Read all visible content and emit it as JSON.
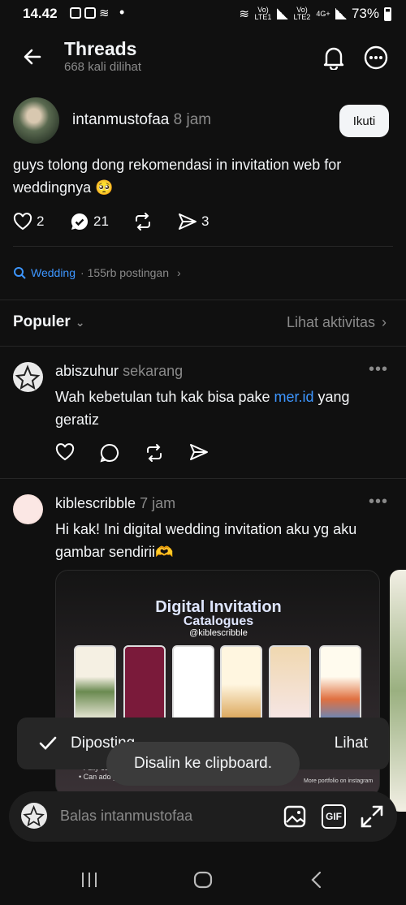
{
  "status_bar": {
    "time": "14.42",
    "network1": "Vo) LTE1",
    "network2": "Vo) LTE2",
    "network_type": "4G+",
    "battery": "73%"
  },
  "header": {
    "title": "Threads",
    "subtitle": "668 kali dilihat"
  },
  "post": {
    "username": "intanmustofaa",
    "time": "8 jam",
    "follow_label": "Ikuti",
    "text": "guys tolong dong rekomendasi in invitation web for weddingnya 🥺",
    "likes": "2",
    "replies": "21",
    "shares": "3"
  },
  "topic": {
    "name": "Wedding",
    "count": "· 155rb postingan"
  },
  "sort": {
    "label": "Populer",
    "activity": "Lihat aktivitas"
  },
  "replies": [
    {
      "username": "abiszuhur",
      "time": "sekarang",
      "text_before": "Wah kebetulan tuh kak bisa pake ",
      "link": "mer.id",
      "text_after": " yang geratiz"
    },
    {
      "username": "kiblescribble",
      "time": "7 jam",
      "text": "Hi kak! Ini digital wedding invitation aku yg aku gambar sendirii🫶"
    }
  ],
  "card": {
    "title1": "Digital Invitation",
    "title2": "Catalogues",
    "handle": "@kiblescribble",
    "bullet1": "• Fully cust...",
    "bullet2": "• Can add personalized guest name",
    "footer": "More portfolio on instagram"
  },
  "toasts": {
    "posted": "Diposting",
    "view": "Lihat",
    "copied": "Disalin ke clipboard."
  },
  "composer": {
    "placeholder": "Balas intanmustofaa",
    "gif": "GIF"
  },
  "colors": {
    "background": "#101010",
    "accent_blue": "#3d96ff",
    "text": "#f3f5f7",
    "muted": "#8a8a8a"
  }
}
